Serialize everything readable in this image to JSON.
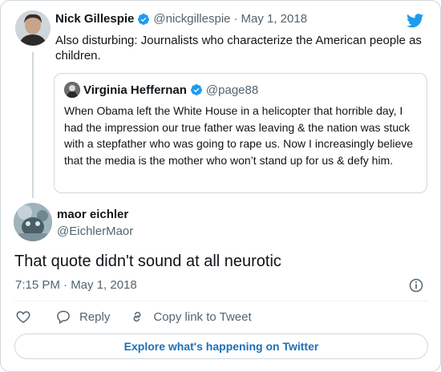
{
  "parent_tweet": {
    "author_name": "Nick Gillespie",
    "handle": "@nickgillespie",
    "separator": "·",
    "date": "May 1, 2018",
    "text": "Also disturbing: Journalists who characterize the American people as children.",
    "verified": true
  },
  "quoted_tweet": {
    "author_name": "Virginia Heffernan",
    "handle": "@page88",
    "verified": true,
    "text": "When Obama left the White House in a helicopter that horrible day, I had the impression our true father was leaving & the nation was stuck with a stepfather who was going to rape us. Now I increasingly believe that the media is the mother who won’t stand up for us & defy him."
  },
  "main_tweet": {
    "author_name": "maor eichler",
    "handle": "@EichlerMaor",
    "text": "That quote didn't sound at all neurotic",
    "timestamp": "7:15 PM · May 1, 2018"
  },
  "actions": {
    "reply_label": "Reply",
    "copy_label": "Copy link to Tweet"
  },
  "explore_label": "Explore what's happening on Twitter",
  "colors": {
    "twitter_blue": "#1d9bf0",
    "link_blue": "#1d6fb8",
    "muted_text": "#536471",
    "border": "#cfd9de"
  },
  "icons": [
    "twitter-bird-icon",
    "verified-badge-icon",
    "info-icon",
    "heart-icon",
    "reply-bubble-icon",
    "link-icon"
  ]
}
